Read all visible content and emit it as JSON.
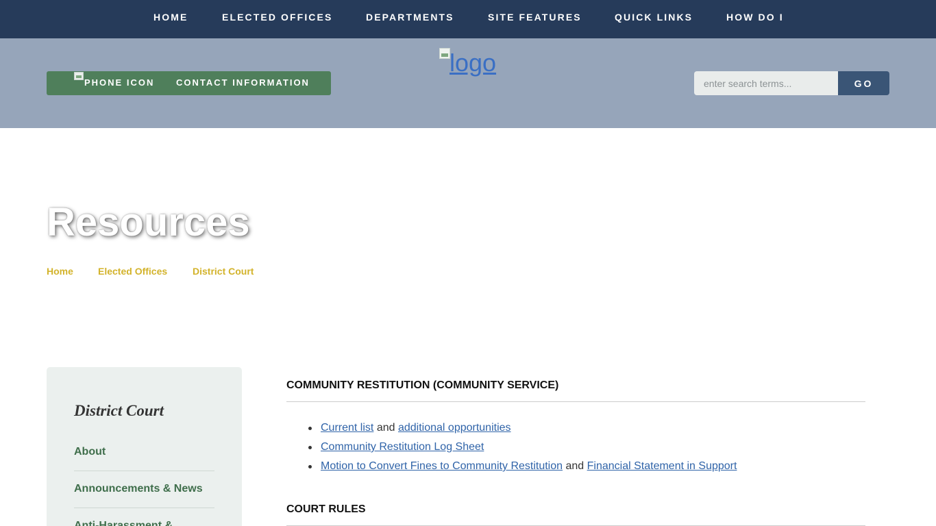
{
  "nav": {
    "items": [
      "Home",
      "Elected Offices",
      "Departments",
      "Site Features",
      "Quick Links",
      "How Do I"
    ]
  },
  "header": {
    "phone_icon_alt": "phone icon",
    "contact_label": "Contact Information",
    "logo_alt": "logo",
    "search_placeholder": "enter search terms...",
    "go_label": "GO"
  },
  "page": {
    "title": "Resources",
    "breadcrumb": [
      "Home",
      "Elected Offices",
      "District Court"
    ]
  },
  "sidebar": {
    "title": "District Court",
    "items": [
      "About",
      "Announcements & News",
      "Anti-Harassment &"
    ]
  },
  "main": {
    "sections": [
      {
        "heading": "COMMUNITY RESTITUTION (COMMUNITY SERVICE)",
        "items": [
          {
            "link1": "Current list",
            "joiner": "and",
            "link2": "additional opportunities"
          },
          {
            "link1": "Community Restitution Log Sheet "
          },
          {
            "link1": "Motion to Convert Fines to Community Restitution",
            "joiner": "and",
            "link2": "Financial Statement in Support"
          }
        ]
      },
      {
        "heading": "COURT RULES"
      }
    ]
  },
  "colors": {
    "nav_bg": "#263b5a",
    "header_bg": "#96a5ba",
    "contact_bar": "#4f7f5b",
    "go_button": "#3a5576",
    "breadcrumb": "#d3b32b",
    "sidebar_bg": "#ebf0ee",
    "sidebar_link": "#3f6e4b",
    "content_link": "#2f63a8"
  }
}
